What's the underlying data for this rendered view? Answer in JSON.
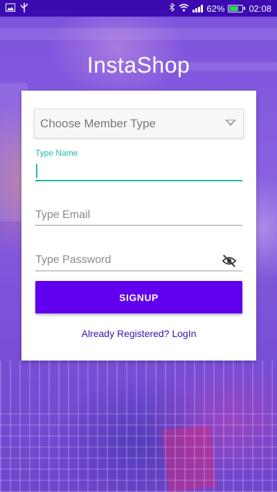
{
  "status_bar": {
    "battery_percent": "62%",
    "time": "02:08",
    "icons": [
      "image-icon",
      "usb-icon",
      "bluetooth-icon",
      "wifi-icon",
      "signal-icon",
      "battery-icon"
    ]
  },
  "app": {
    "title": "InstaShop"
  },
  "form": {
    "member_type": {
      "selected": "Choose Member Type"
    },
    "name": {
      "label": "Type Name",
      "value": ""
    },
    "email": {
      "placeholder": "Type Email",
      "value": ""
    },
    "password": {
      "placeholder": "Type Password",
      "value": ""
    },
    "signup_label": "SIGNUP",
    "login_link": "Already Registered? LogIn"
  },
  "colors": {
    "accent": "#1fb5b0",
    "primary": "#6100ee",
    "status_bar": "#3b0ab0",
    "link": "#3a0fb0"
  }
}
